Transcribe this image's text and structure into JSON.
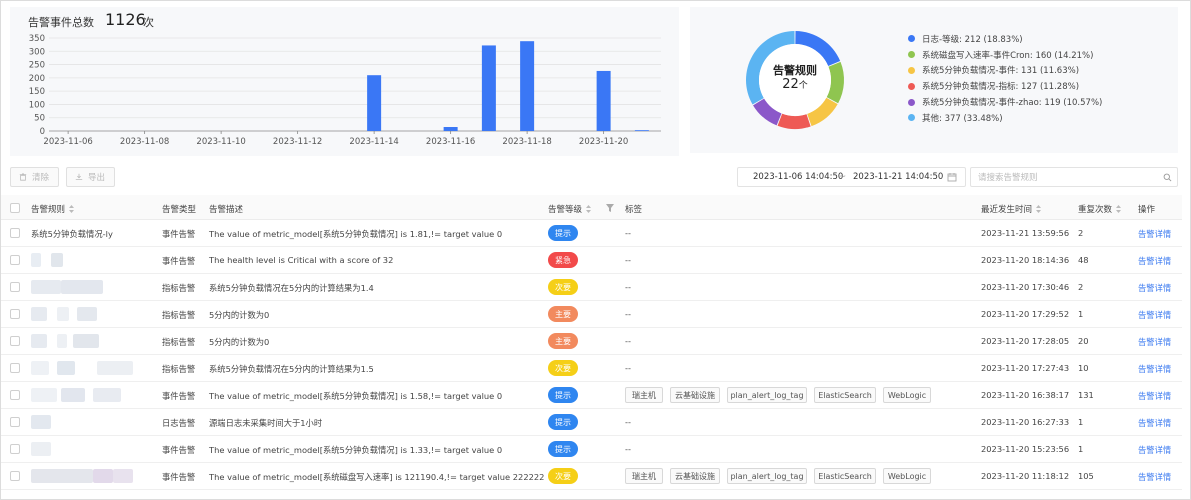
{
  "summary": {
    "label": "告警事件总数",
    "value": "1126",
    "unit": "次"
  },
  "chart_data": [
    {
      "type": "bar",
      "title": "",
      "y_ticks": [
        0,
        50,
        100,
        150,
        200,
        250,
        300,
        350
      ],
      "ylim": [
        0,
        350
      ],
      "x_tick_labels": [
        "2023-11-06",
        "2023-11-08",
        "2023-11-10",
        "2023-11-12",
        "2023-11-14",
        "2023-11-16",
        "2023-11-18",
        "2023-11-20"
      ],
      "categories": [
        "2023-11-06",
        "2023-11-07",
        "2023-11-08",
        "2023-11-09",
        "2023-11-10",
        "2023-11-11",
        "2023-11-12",
        "2023-11-13",
        "2023-11-14",
        "2023-11-15",
        "2023-11-16",
        "2023-11-17",
        "2023-11-18",
        "2023-11-19",
        "2023-11-20",
        "2023-11-21"
      ],
      "values": [
        0,
        0,
        0,
        0,
        0,
        0,
        0,
        0,
        210,
        0,
        15,
        322,
        338,
        0,
        226,
        3
      ],
      "color": "#3a77f5",
      "grid": true
    },
    {
      "type": "pie",
      "center_title": "告警规则",
      "center_value": "22",
      "center_unit": "个",
      "slices": [
        {
          "label": "日志-等级: 212 (18.83%)",
          "value": 212,
          "color": "#3a77f5"
        },
        {
          "label": "系统磁盘写入速率-事件Cron: 160 (14.21%)",
          "value": 160,
          "color": "#8fc550"
        },
        {
          "label": "系统5分钟负载情况-事件: 131 (11.63%)",
          "value": 131,
          "color": "#f6c545"
        },
        {
          "label": "系统5分钟负载情况-指标: 127 (11.28%)",
          "value": 127,
          "color": "#ee5a55"
        },
        {
          "label": "系统5分钟负载情况-事件-zhao: 119 (10.57%)",
          "value": 119,
          "color": "#8b58c9"
        },
        {
          "label": "其他: 377 (33.48%)",
          "value": 377,
          "color": "#5bb4f2"
        }
      ],
      "legend_position": "right"
    }
  ],
  "toolbar": {
    "clear_label": "清除",
    "export_label": "导出",
    "date_start": "2023-11-06 14:04:50",
    "date_sep": "~",
    "date_end": "2023-11-21 14:04:50",
    "search_placeholder": "请搜索告警规则"
  },
  "table": {
    "headers": {
      "rule": "告警规则",
      "type": "告警类型",
      "desc": "告警描述",
      "level": "告警等级",
      "tags": "标签",
      "time": "最近发生时间",
      "count": "重复次数",
      "op": "操作"
    },
    "level_colors": {
      "提示": "#2f86f0",
      "紧急": "#f24a4a",
      "次要": "#f5cf17",
      "主要": "#f28a5e"
    },
    "rows": [
      {
        "rule": "系统5分钟负载情况-ly",
        "type": "事件告警",
        "desc": "The value of metric_model[系统5分钟负载情况] is 1.81,!= target value 0",
        "level": "提示",
        "tags": [
          "--"
        ],
        "time": "2023-11-21 13:59:56",
        "count": "2",
        "op": "告警详情"
      },
      {
        "rule": "",
        "type": "事件告警",
        "desc": "The health level is Critical with a score of 32",
        "level": "紧急",
        "tags": [
          "--"
        ],
        "time": "2023-11-20 18:14:36",
        "count": "48",
        "op": "告警详情"
      },
      {
        "rule": "",
        "type": "指标告警",
        "desc": "系统5分钟负载情况在5分内的计算结果为1.4",
        "level": "次要",
        "tags": [
          "--"
        ],
        "time": "2023-11-20 17:30:46",
        "count": "2",
        "op": "告警详情"
      },
      {
        "rule": "",
        "type": "指标告警",
        "desc": "5分内的计数为0",
        "level": "主要",
        "tags": [
          "--"
        ],
        "time": "2023-11-20 17:29:52",
        "count": "1",
        "op": "告警详情"
      },
      {
        "rule": "",
        "type": "指标告警",
        "desc": "5分内的计数为0",
        "level": "主要",
        "tags": [
          "--"
        ],
        "time": "2023-11-20 17:28:05",
        "count": "20",
        "op": "告警详情"
      },
      {
        "rule": "",
        "type": "指标告警",
        "desc": "系统5分钟负载情况在5分内的计算结果为1.5",
        "level": "次要",
        "tags": [
          "--"
        ],
        "time": "2023-11-20 17:27:43",
        "count": "10",
        "op": "告警详情"
      },
      {
        "rule": "",
        "type": "事件告警",
        "desc": "The value of metric_model[系统5分钟负载情况] is 1.58,!= target value 0",
        "level": "提示",
        "tags": [
          "瑞主机",
          "云基础设施",
          "plan_alert_log_tag",
          "ElasticSearch",
          "WebLogic"
        ],
        "time": "2023-11-20 16:38:17",
        "count": "131",
        "op": "告警详情"
      },
      {
        "rule": "",
        "type": "日志告警",
        "desc": "源端日志未采集时间大于1小时",
        "level": "提示",
        "tags": [
          "--"
        ],
        "time": "2023-11-20 16:27:33",
        "count": "1",
        "op": "告警详情"
      },
      {
        "rule": "",
        "type": "事件告警",
        "desc": "The value of metric_model[系统5分钟负载情况] is 1.33,!= target value 0",
        "level": "提示",
        "tags": [
          "--"
        ],
        "time": "2023-11-20 15:23:56",
        "count": "1",
        "op": "告警详情"
      },
      {
        "rule": "",
        "type": "事件告警",
        "desc": "The value of metric_model[系统磁盘写入速率] is 121190.4,!= target value 222222",
        "level": "次要",
        "tags": [
          "瑞主机",
          "云基础设施",
          "plan_alert_log_tag",
          "ElasticSearch",
          "WebLogic"
        ],
        "time": "2023-11-20 11:18:12",
        "count": "105",
        "op": "告警详情"
      }
    ]
  }
}
